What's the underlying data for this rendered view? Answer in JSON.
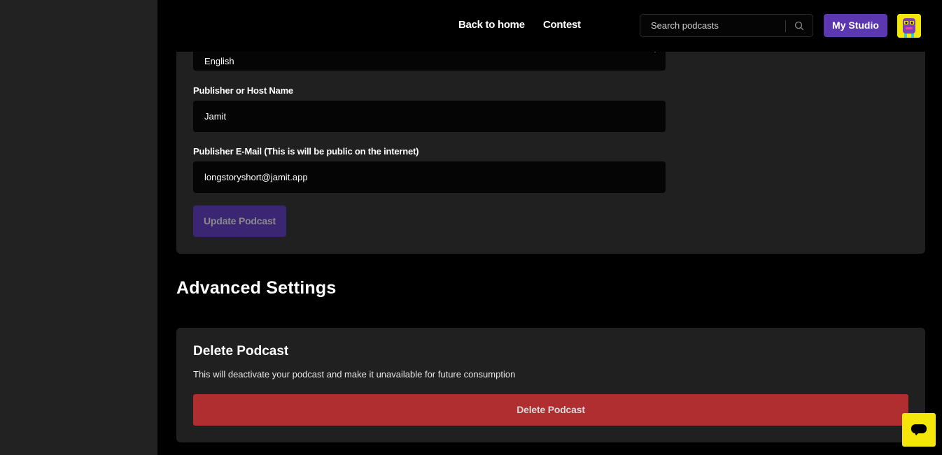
{
  "header": {
    "nav": [
      {
        "label": "Back to home"
      },
      {
        "label": "Contest"
      }
    ],
    "search": {
      "placeholder": "Search podcasts",
      "value": ""
    },
    "studio_label": "My Studio"
  },
  "podcast_form": {
    "language": {
      "value": "English"
    },
    "publisher_name": {
      "label": "Publisher or Host Name",
      "value": "Jamit"
    },
    "publisher_email": {
      "label": "Publisher E-Mail (This is will be public on the internet)",
      "value": "longstoryshort@jamit.app"
    },
    "update_label": "Update Podcast"
  },
  "advanced": {
    "title": "Advanced Settings",
    "delete_card": {
      "title": "Delete Podcast",
      "description": "This will deactivate your podcast and make it unavailable for future consumption",
      "button_label": "Delete Podcast"
    }
  },
  "colors": {
    "accent": "#5b37b0",
    "danger": "#b02e30",
    "brand_yellow": "#f5e60a"
  }
}
